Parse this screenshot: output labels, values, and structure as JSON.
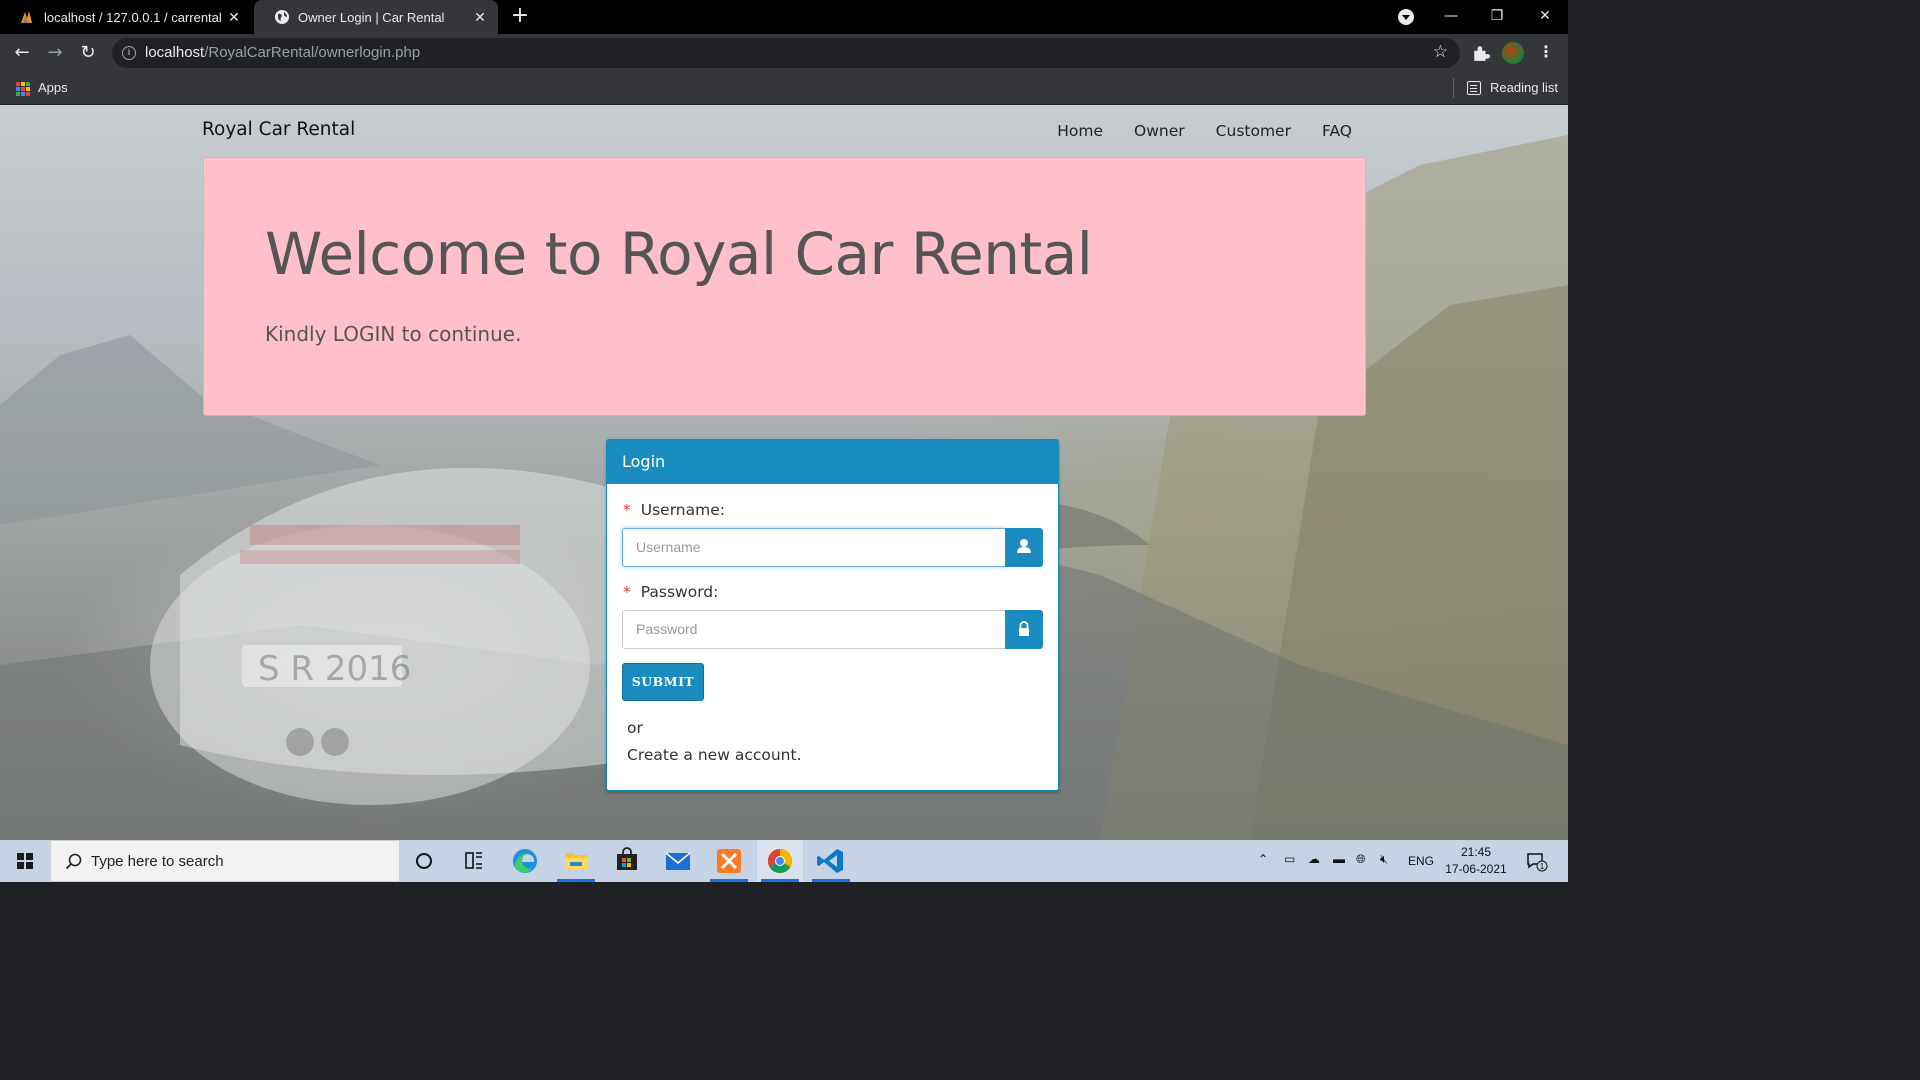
{
  "browser": {
    "tabs": [
      {
        "title": "localhost / 127.0.0.1 / carrental | ",
        "active": false,
        "favicon": "phpmyadmin-icon"
      },
      {
        "title": "Owner Login | Car Rental",
        "active": true,
        "favicon": "globe-icon"
      }
    ],
    "url": {
      "host": "localhost",
      "path": "/RoyalCarRental/ownerlogin.php"
    },
    "bookmarks": {
      "apps_label": "Apps",
      "reading_list_label": "Reading list"
    }
  },
  "page": {
    "brand": "Royal Car Rental",
    "nav": [
      "Home",
      "Owner",
      "Customer",
      "FAQ"
    ],
    "jumbotron": {
      "heading": "Welcome to Royal Car Rental",
      "subtext": "Kindly LOGIN to continue.",
      "bg_color": "#ffc0cb"
    },
    "login": {
      "header": "Login",
      "username_label": "Username:",
      "username_placeholder": "Username",
      "password_label": "Password:",
      "password_placeholder": "Password",
      "required_marker": "*",
      "submit_label": "SUBMIT",
      "or_text": "or",
      "create_account_text": "Create a new account."
    },
    "accent_color": "#1a8bbf"
  },
  "taskbar": {
    "search_placeholder": "Type here to search",
    "language": "ENG",
    "time": "21:45",
    "date": "17-06-2021",
    "notification_count": "1",
    "apps": [
      "cortana-icon",
      "task-view-icon",
      "edge-icon",
      "file-explorer-icon",
      "store-icon",
      "mail-icon",
      "xampp-icon",
      "chrome-icon",
      "vscode-icon"
    ]
  }
}
